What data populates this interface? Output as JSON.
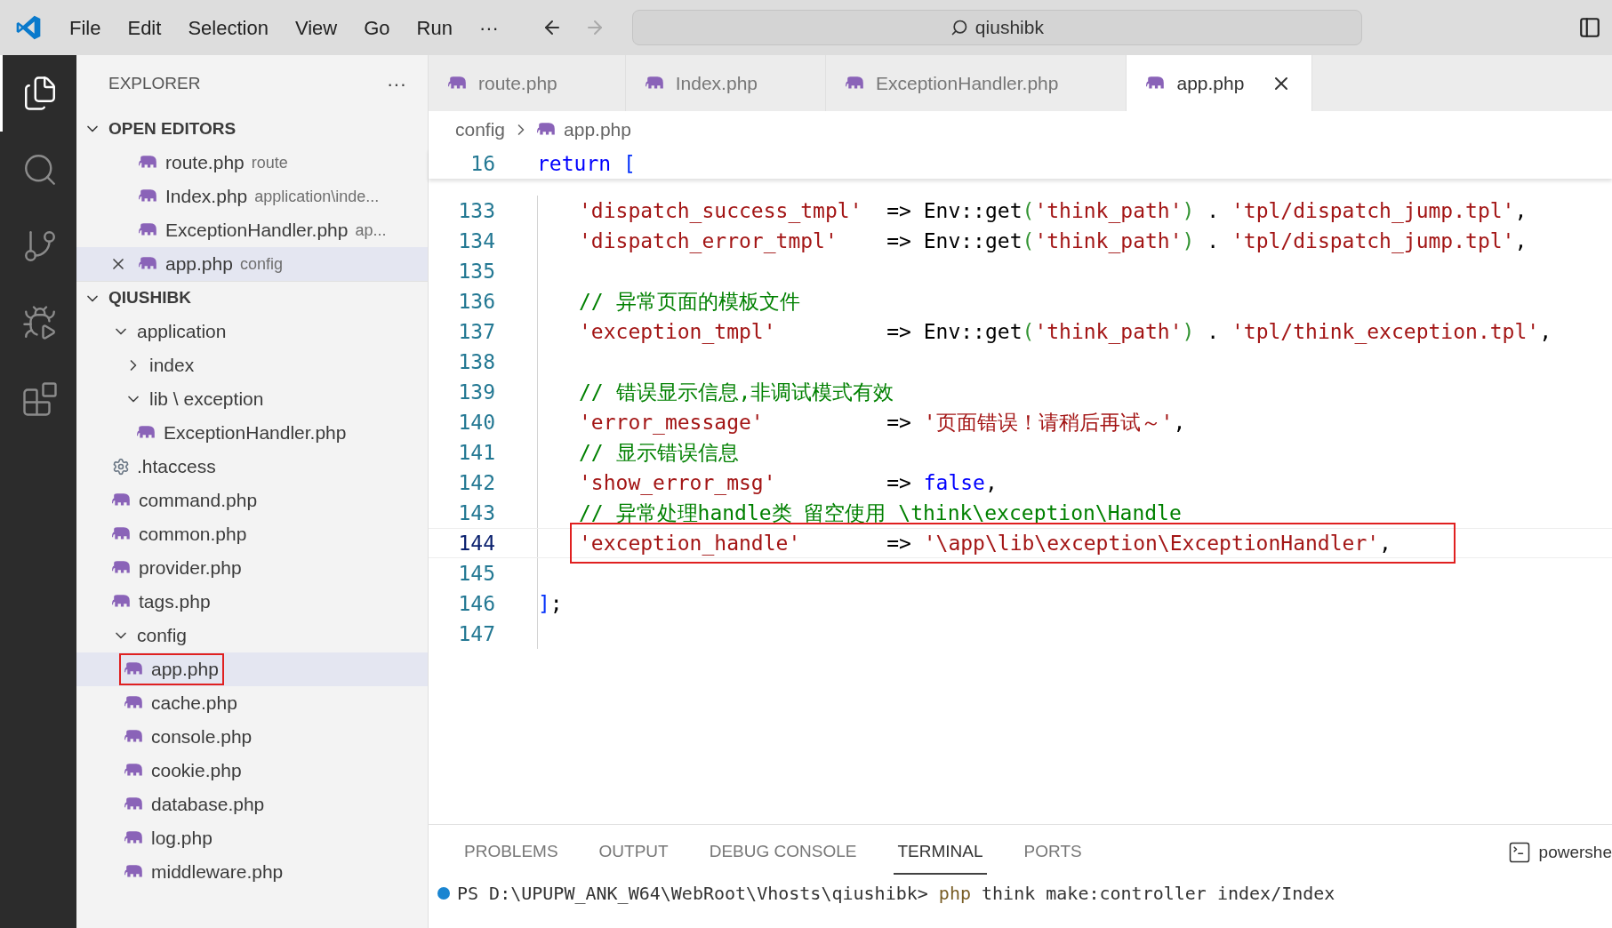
{
  "title_bar": {
    "menu": [
      "File",
      "Edit",
      "Selection",
      "View",
      "Go",
      "Run",
      "···"
    ],
    "search": {
      "value": "qiushibk"
    }
  },
  "activity_bar": {
    "items": [
      {
        "kind": "files",
        "selected": true
      },
      {
        "kind": "search",
        "selected": false
      },
      {
        "kind": "source",
        "selected": false
      },
      {
        "kind": "debug",
        "selected": false
      },
      {
        "kind": "extensions",
        "selected": false
      }
    ]
  },
  "sidebar": {
    "title": "EXPLORER",
    "more": "···",
    "open_editors": {
      "label": "OPEN EDITORS",
      "expanded": true,
      "items": [
        {
          "name": "route.php",
          "description": "route",
          "selected": false
        },
        {
          "name": "Index.php",
          "description": "application\\inde...",
          "selected": false
        },
        {
          "name": "ExceptionHandler.php",
          "description": "ap...",
          "selected": false
        },
        {
          "name": "app.php",
          "description": "config",
          "selected": true
        }
      ]
    },
    "folder": {
      "label": "QIUSHIBK",
      "expanded": true,
      "tree": [
        {
          "name": "application",
          "kind": "folder",
          "expanded": true,
          "children": [
            {
              "name": "index",
              "kind": "folder",
              "expanded": false
            },
            {
              "name": "lib \\ exception",
              "kind": "folder",
              "expanded": true,
              "children": [
                {
                  "name": "ExceptionHandler.php",
                  "kind": "php",
                  "selected": false,
                  "annotated": false
                }
              ]
            }
          ]
        },
        {
          "name": ".htaccess",
          "kind": "config",
          "selected": false,
          "annotated": false
        },
        {
          "name": "command.php",
          "kind": "php",
          "selected": false,
          "annotated": false
        },
        {
          "name": "common.php",
          "kind": "php",
          "selected": false,
          "annotated": false
        },
        {
          "name": "provider.php",
          "kind": "php",
          "selected": false,
          "annotated": false
        },
        {
          "name": "tags.php",
          "kind": "php",
          "selected": false,
          "annotated": false
        },
        {
          "name": "config",
          "kind": "folder",
          "expanded": true,
          "children": [
            {
              "name": "app.php",
              "kind": "php",
              "selected": true,
              "annotated": true
            },
            {
              "name": "cache.php",
              "kind": "php",
              "selected": false,
              "annotated": false
            },
            {
              "name": "console.php",
              "kind": "php",
              "selected": false,
              "annotated": false
            },
            {
              "name": "cookie.php",
              "kind": "php",
              "selected": false,
              "annotated": false
            },
            {
              "name": "database.php",
              "kind": "php",
              "selected": false,
              "annotated": false
            },
            {
              "name": "log.php",
              "kind": "php",
              "selected": false,
              "annotated": false
            },
            {
              "name": "middleware.php",
              "kind": "php",
              "selected": false,
              "annotated": false
            }
          ]
        }
      ]
    }
  },
  "editor": {
    "tabs": [
      {
        "label": "route.php",
        "selected": false
      },
      {
        "label": "Index.php",
        "selected": false
      },
      {
        "label": "ExceptionHandler.php",
        "selected": false
      },
      {
        "label": "app.php",
        "selected": true
      }
    ],
    "breadcrumb": [
      "config",
      "app.php"
    ],
    "sticky_line": {
      "number": "16",
      "tokens": [
        {
          "kind": "kw",
          "text": "return"
        },
        {
          "kind": "br1",
          "text": " ["
        }
      ]
    },
    "lines": [
      {
        "number": "133",
        "current": false,
        "indent": true,
        "tokens": [
          {
            "kind": "str",
            "text": "'dispatch_success_tmpl'"
          },
          {
            "kind": "txt",
            "text": "  => Env::get"
          },
          {
            "kind": "br2",
            "text": "("
          },
          {
            "kind": "str",
            "text": "'think_path'"
          },
          {
            "kind": "br2",
            "text": ")"
          },
          {
            "kind": "txt",
            "text": " . "
          },
          {
            "kind": "str",
            "text": "'tpl/dispatch_jump.tpl'"
          },
          {
            "kind": "txt",
            "text": ","
          }
        ]
      },
      {
        "number": "134",
        "current": false,
        "indent": true,
        "tokens": [
          {
            "kind": "str",
            "text": "'dispatch_error_tmpl'"
          },
          {
            "kind": "txt",
            "text": "    => Env::get"
          },
          {
            "kind": "br2",
            "text": "("
          },
          {
            "kind": "str",
            "text": "'think_path'"
          },
          {
            "kind": "br2",
            "text": ")"
          },
          {
            "kind": "txt",
            "text": " . "
          },
          {
            "kind": "str",
            "text": "'tpl/dispatch_jump.tpl'"
          },
          {
            "kind": "txt",
            "text": ","
          }
        ]
      },
      {
        "number": "135",
        "current": false
      },
      {
        "number": "136",
        "current": false,
        "indent": true,
        "tokens": [
          {
            "kind": "cmt",
            "text": "// 异常页面的模板文件"
          }
        ]
      },
      {
        "number": "137",
        "current": false,
        "indent": true,
        "tokens": [
          {
            "kind": "str",
            "text": "'exception_tmpl'"
          },
          {
            "kind": "txt",
            "text": "         => Env::get"
          },
          {
            "kind": "br2",
            "text": "("
          },
          {
            "kind": "str",
            "text": "'think_path'"
          },
          {
            "kind": "br2",
            "text": ")"
          },
          {
            "kind": "txt",
            "text": " . "
          },
          {
            "kind": "str",
            "text": "'tpl/think_exception.tpl'"
          },
          {
            "kind": "txt",
            "text": ","
          }
        ]
      },
      {
        "number": "138",
        "current": false
      },
      {
        "number": "139",
        "current": false,
        "indent": true,
        "tokens": [
          {
            "kind": "cmt",
            "text": "// 错误显示信息,非调试模式有效"
          }
        ]
      },
      {
        "number": "140",
        "current": false,
        "indent": true,
        "tokens": [
          {
            "kind": "str",
            "text": "'error_message'"
          },
          {
            "kind": "txt",
            "text": "          => "
          },
          {
            "kind": "str",
            "text": "'页面错误！请稍后再试～'"
          },
          {
            "kind": "txt",
            "text": ","
          }
        ]
      },
      {
        "number": "141",
        "current": false,
        "indent": true,
        "tokens": [
          {
            "kind": "cmt",
            "text": "// 显示错误信息"
          }
        ]
      },
      {
        "number": "142",
        "current": false,
        "indent": true,
        "tokens": [
          {
            "kind": "str",
            "text": "'show_error_msg'"
          },
          {
            "kind": "txt",
            "text": "         => "
          },
          {
            "kind": "kw",
            "text": "false"
          },
          {
            "kind": "txt",
            "text": ","
          }
        ]
      },
      {
        "number": "143",
        "current": false,
        "indent": true,
        "tokens": [
          {
            "kind": "cmt",
            "text": "// 异常处理handle类 留空使用 \\think\\exception\\Handle"
          }
        ]
      },
      {
        "number": "144",
        "current": true,
        "indent": true,
        "annotated": true,
        "tokens": [
          {
            "kind": "str",
            "text": "'exception_handle'"
          },
          {
            "kind": "txt",
            "text": "       => "
          },
          {
            "kind": "str",
            "text": "'\\app\\lib\\exception\\ExceptionHandler'"
          },
          {
            "kind": "txt",
            "text": ","
          }
        ]
      },
      {
        "number": "145",
        "current": false
      },
      {
        "number": "146",
        "current": false,
        "indent": false,
        "tokens": [
          {
            "kind": "br1",
            "text": "]"
          },
          {
            "kind": "txt",
            "text": ";"
          }
        ]
      },
      {
        "number": "147",
        "current": false
      }
    ]
  },
  "panel": {
    "tabs": [
      {
        "label": "PROBLEMS",
        "selected": false
      },
      {
        "label": "OUTPUT",
        "selected": false
      },
      {
        "label": "DEBUG CONSOLE",
        "selected": false
      },
      {
        "label": "TERMINAL",
        "selected": true
      },
      {
        "label": "PORTS",
        "selected": false
      }
    ],
    "shell": "powershe",
    "terminal": {
      "prompt": "PS D:\\UPUPW_ANK_W64\\WebRoot\\Vhosts\\qiushibk>",
      "command": [
        {
          "kind": "cmd",
          "text": "php"
        },
        {
          "kind": "arg",
          "text": " think make:controller index/Index"
        }
      ]
    }
  }
}
